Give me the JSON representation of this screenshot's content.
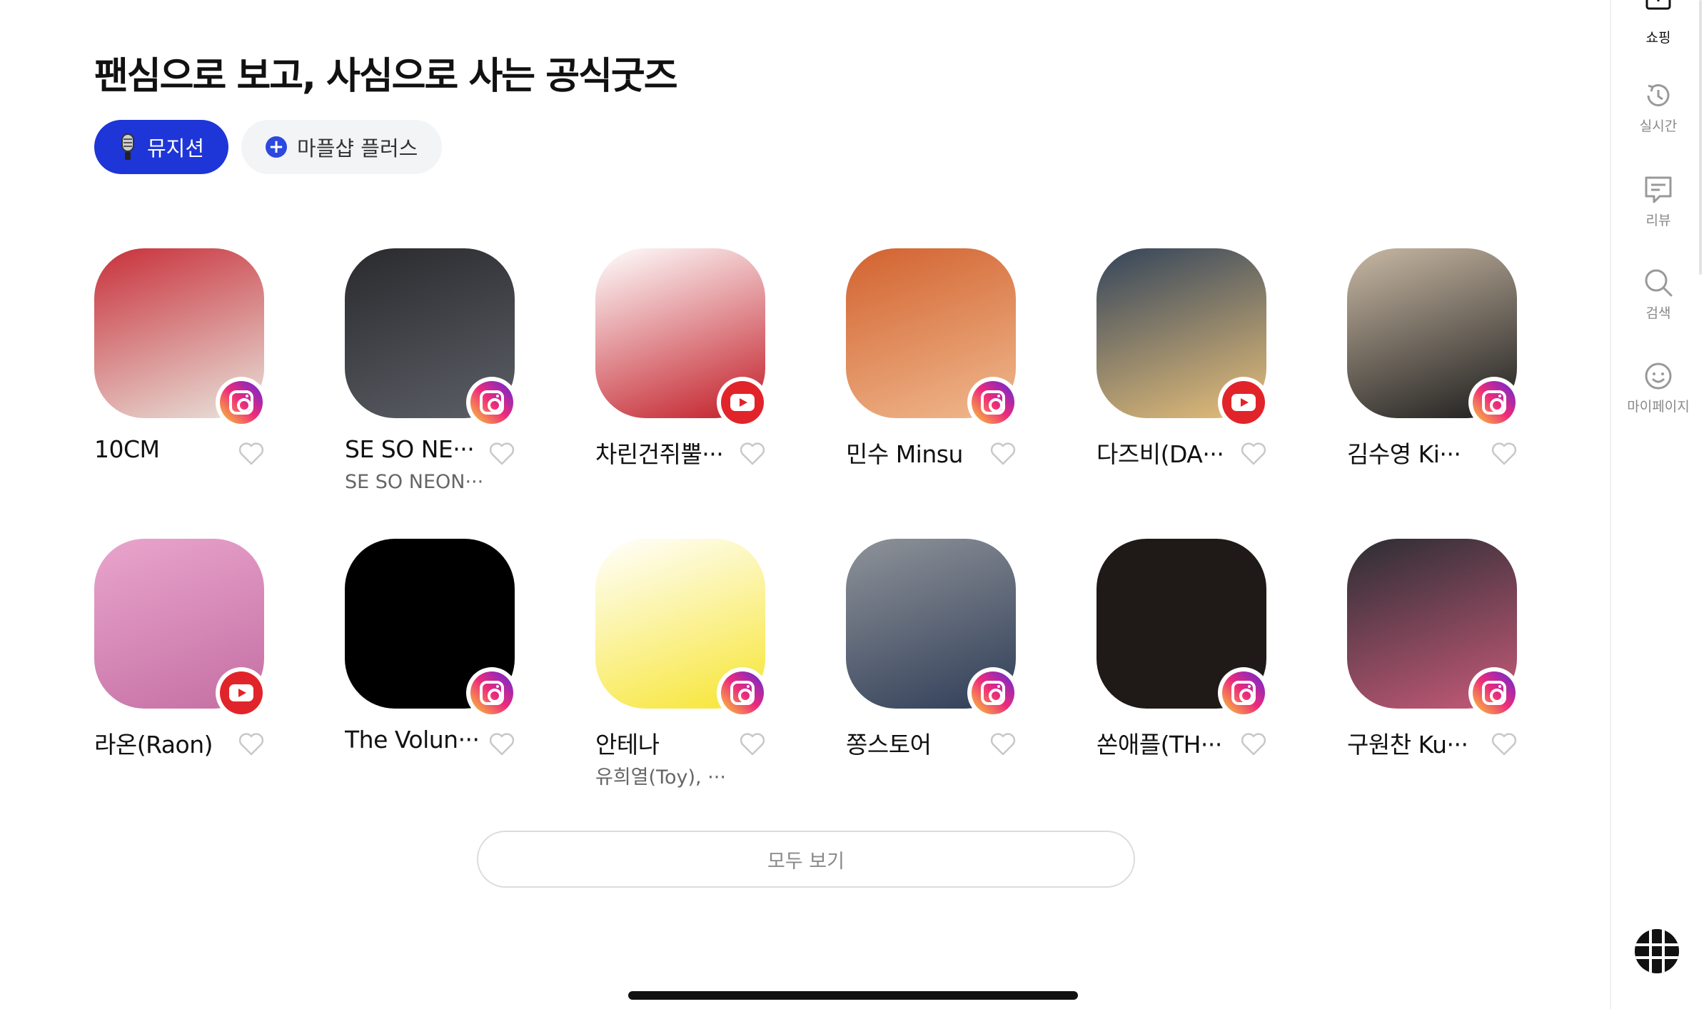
{
  "title": "팬심으로 보고, 사심으로 사는 공식굿즈",
  "chips": [
    {
      "label": "뮤지션",
      "active": true,
      "icon": "microphone-icon"
    },
    {
      "label": "마플샵 플러스",
      "active": false,
      "icon": "plus-circle-icon"
    }
  ],
  "artists": [
    {
      "name": "10CM",
      "sub": "",
      "badge": "instagram",
      "colors": [
        "#c8303a",
        "#e9e4dc"
      ]
    },
    {
      "name": "SE SO NE···",
      "sub": "SE SO NEON···",
      "badge": "instagram",
      "colors": [
        "#2a2a2e",
        "#5b5f66"
      ]
    },
    {
      "name": "차린건쥐뿔···",
      "sub": "",
      "badge": "youtube",
      "colors": [
        "#ffffff",
        "#c21c26"
      ]
    },
    {
      "name": "민수 Minsu",
      "sub": "",
      "badge": "instagram",
      "colors": [
        "#d2622f",
        "#f0b98e"
      ]
    },
    {
      "name": "다즈비(DA···",
      "sub": "",
      "badge": "youtube",
      "colors": [
        "#33445a",
        "#e8c07a"
      ]
    },
    {
      "name": "김수영 Ki···",
      "sub": "",
      "badge": "instagram",
      "colors": [
        "#c9b9a4",
        "#1c1c1c"
      ]
    },
    {
      "name": "라온(Raon)",
      "sub": "",
      "badge": "youtube",
      "colors": [
        "#e9a5cc",
        "#c46fa3"
      ]
    },
    {
      "name": "The Volun···",
      "sub": "",
      "badge": "instagram",
      "colors": [
        "#000000",
        "#000000"
      ]
    },
    {
      "name": "안테나",
      "sub": "유희열(Toy), ···",
      "badge": "instagram",
      "colors": [
        "#ffffff",
        "#f7e531"
      ]
    },
    {
      "name": "쫑스토어",
      "sub": "",
      "badge": "instagram",
      "colors": [
        "#8f9399",
        "#2f3d57"
      ]
    },
    {
      "name": "쏜애플(TH···",
      "sub": "",
      "badge": "instagram",
      "colors": [
        "#1f1a18",
        "#1f1a18"
      ]
    },
    {
      "name": "구원찬 Ku···",
      "sub": "",
      "badge": "instagram",
      "colors": [
        "#2b2d33",
        "#c75a79"
      ]
    }
  ],
  "view_all": "모두 보기",
  "sidebar": [
    {
      "label": "쇼핑",
      "icon": "shopping-icon",
      "active": true
    },
    {
      "label": "실시간",
      "icon": "realtime-icon",
      "active": false
    },
    {
      "label": "리뷰",
      "icon": "review-icon",
      "active": false
    },
    {
      "label": "검색",
      "icon": "search-icon",
      "active": false
    },
    {
      "label": "마이페이지",
      "icon": "mypage-icon",
      "active": false
    }
  ],
  "colors": {
    "accent": "#1e35d8",
    "instagram": "#ee2a7b",
    "youtube": "#e1242a"
  }
}
